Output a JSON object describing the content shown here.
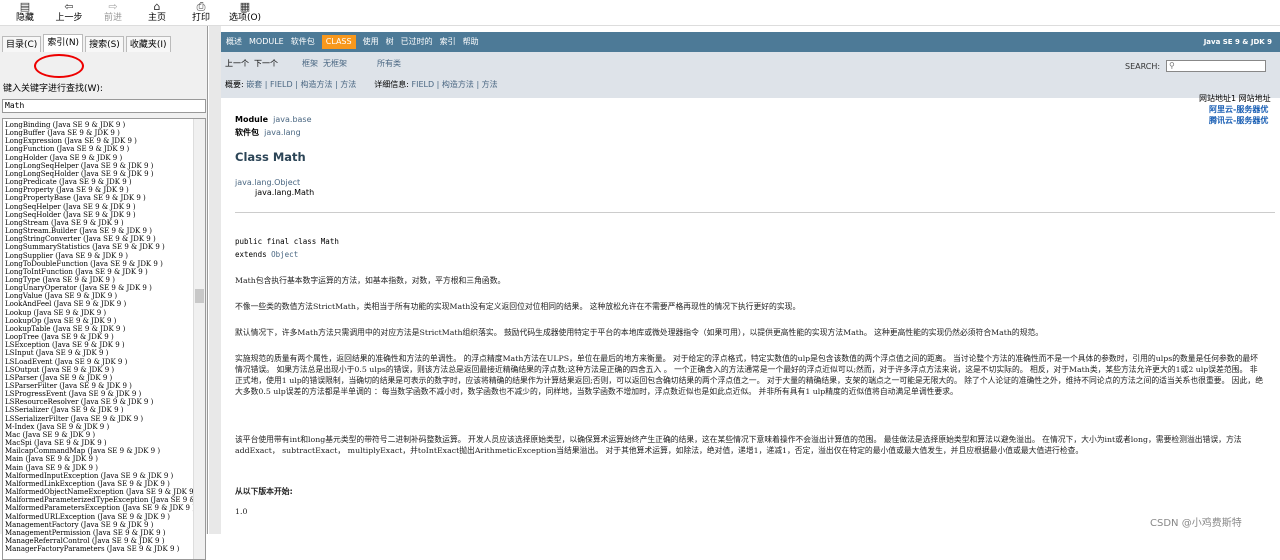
{
  "toolbar": {
    "items": [
      {
        "label": "隐藏",
        "icon": "hide-icon",
        "disabled": false
      },
      {
        "label": "上一步",
        "icon": "back-arrow-icon",
        "disabled": false
      },
      {
        "label": "前进",
        "icon": "forward-arrow-icon",
        "disabled": true
      },
      {
        "label": "主页",
        "icon": "home-icon",
        "disabled": false
      },
      {
        "label": "打印",
        "icon": "print-icon",
        "disabled": false
      },
      {
        "label": "选项(O)",
        "icon": "options-icon",
        "disabled": false
      }
    ]
  },
  "sidebar": {
    "tabs": [
      {
        "label": "目录(C)",
        "active": false
      },
      {
        "label": "索引(N)",
        "active": true
      },
      {
        "label": "搜索(S)",
        "active": false
      },
      {
        "label": "收藏夹(I)",
        "active": false
      }
    ],
    "keyword_label": "键入关键字进行查找(W):",
    "keyword_value": "Math",
    "index_items": [
      "LongBinding (Java SE 9 & JDK 9 )",
      "LongBuffer (Java SE 9 & JDK 9 )",
      "LongExpression (Java SE 9 & JDK 9 )",
      "LongFunction (Java SE 9 & JDK 9 )",
      "LongHolder (Java SE 9 & JDK 9 )",
      "LongLongSeqHelper (Java SE 9 & JDK 9 )",
      "LongLongSeqHolder (Java SE 9 & JDK 9 )",
      "LongPredicate (Java SE 9 & JDK 9 )",
      "LongProperty (Java SE 9 & JDK 9 )",
      "LongPropertyBase (Java SE 9 & JDK 9 )",
      "LongSeqHelper (Java SE 9 & JDK 9 )",
      "LongSeqHolder (Java SE 9 & JDK 9 )",
      "LongStream (Java SE 9 & JDK 9 )",
      "LongStream.Builder (Java SE 9 & JDK 9 )",
      "LongStringConverter (Java SE 9 & JDK 9 )",
      "LongSummaryStatistics (Java SE 9 & JDK 9 )",
      "LongSupplier (Java SE 9 & JDK 9 )",
      "LongToDoubleFunction (Java SE 9 & JDK 9 )",
      "LongToIntFunction (Java SE 9 & JDK 9 )",
      "LongType (Java SE 9 & JDK 9 )",
      "LongUnaryOperator (Java SE 9 & JDK 9 )",
      "LongValue (Java SE 9 & JDK 9 )",
      "LookAndFeel (Java SE 9 & JDK 9 )",
      "Lookup (Java SE 9 & JDK 9 )",
      "LookupOp (Java SE 9 & JDK 9 )",
      "LookupTable (Java SE 9 & JDK 9 )",
      "LoopTree (Java SE 9 & JDK 9 )",
      "LSException (Java SE 9 & JDK 9 )",
      "LSInput (Java SE 9 & JDK 9 )",
      "LSLoadEvent (Java SE 9 & JDK 9 )",
      "LSOutput (Java SE 9 & JDK 9 )",
      "LSParser (Java SE 9 & JDK 9 )",
      "LSParserFilter (Java SE 9 & JDK 9 )",
      "LSProgressEvent (Java SE 9 & JDK 9 )",
      "LSResourceResolver (Java SE 9 & JDK 9 )",
      "LSSerializer (Java SE 9 & JDK 9 )",
      "LSSerializerFilter (Java SE 9 & JDK 9 )",
      "M-Index (Java SE 9 & JDK 9 )",
      "Mac (Java SE 9 & JDK 9 )",
      "MacSpi (Java SE 9 & JDK 9 )",
      "MailcapCommandMap (Java SE 9 & JDK 9 )",
      "Main (Java SE 9 & JDK 9 )",
      "Main (Java SE 9 & JDK 9 )",
      "MalformedInputException (Java SE 9 & JDK 9 )",
      "MalformedLinkException (Java SE 9 & JDK 9 )",
      "MalformedObjectNameException (Java SE 9 & JDK 9 )",
      "MalformedParameterizedTypeException (Java SE 9 & JDK 9 )",
      "MalformedParametersException (Java SE 9 & JDK 9 )",
      "MalformedURLException (Java SE 9 & JDK 9 )",
      "ManagementFactory (Java SE 9 & JDK 9 )",
      "ManagementPermission (Java SE 9 & JDK 9 )",
      "ManageReferralControl (Java SE 9 & JDK 9 )",
      "ManagerFactoryParameters (Java SE 9 & JDK 9 )"
    ]
  },
  "navbar": {
    "items": [
      {
        "label": "概述",
        "selected": false
      },
      {
        "label": "MODULE",
        "selected": false
      },
      {
        "label": "软件包",
        "selected": false
      },
      {
        "label": "CLASS",
        "selected": true
      },
      {
        "label": "使用",
        "selected": false
      },
      {
        "label": "树",
        "selected": false
      },
      {
        "label": "已过时的",
        "selected": false
      },
      {
        "label": "索引",
        "selected": false
      },
      {
        "label": "帮助",
        "selected": false
      }
    ],
    "brand": "Java SE 9 & JDK 9"
  },
  "subnav": {
    "prev": "上一个",
    "next": "下一个",
    "frames": "框架",
    "noframes": "无框架",
    "allclasses": "所有类",
    "search_label": "SEARCH:",
    "summary_label": "概要:",
    "summary_items": "嵌套 | FIELD | 构造方法 | 方法",
    "detail_label": "详细信息:",
    "detail_items": "FIELD | 构造方法 | 方法"
  },
  "doc": {
    "module_label": "Module",
    "module_value": "java.base",
    "package_label": "软件包",
    "package_value": "java.lang",
    "class_title": "Class Math",
    "inherit_parent": "java.lang.Object",
    "inherit_child": "java.lang.Math",
    "sig_line1": "public final class Math",
    "sig_line2_kw": "extends",
    "sig_line2_val": "Object",
    "p1": "Math包含执行基本数字运算的方法，如基本指数，对数，平方根和三角函数。",
    "p2": "不像一些类的数值方法StrictMath，类相当于所有功能的实现Math没有定义返回位对位相同的结果。 这种放松允许在不需要严格再现性的情况下执行更好的实现。",
    "p3": "默认情况下，许多Math方法只需调用中的对应方法是StrictMath组织落实。 鼓励代码生成器使用特定于平台的本地库或微处理器指令（如果可用），以提供更高性能的实现方法Math。 这种更高性能的实现仍然必须符合Math的规范。",
    "p4": "实施规范的质量有两个属性，返回结果的准确性和方法的单调性。 的浮点精度Math方法在ULPS，单位在最后的地方来衡量。 对于给定的浮点格式，特定实数值的ulp是包含该数值的两个浮点值之间的距离。 当讨论整个方法的准确性而不是一个具体的参数时，引用的ulps的数量是任何参数的最坏情况错误。 如果方法总是出现小于0.5 ulps的错误，则该方法总是返回最接近精确结果的浮点数;这种方法是正确的四舍五入 。 一个正确舍入的方法通常是一个最好的浮点近似可以;然而，对于许多浮点方法来说，这是不切实际的。 相反，对于Math类，某些方法允许更大的1或2 ulp误差范围。 非正式地，使用1 ulp的错误限制，当确切的结果是可表示的数字时，应该将精确的结果作为计算结果返回;否则，可以返回包含确切结果的两个浮点值之一。 对于大量的精确结果，支架的端点之一可能是无限大的。 除了个人论证的准确性之外，维持不同论点的方法之间的适当关系也很重要。 因此，绝大多数0.5 ulp误差的方法都是半单调的 ：每当数学函数不减小时，数学函数也不减少的，同样地，当数学函数不增加时，浮点数近似也是如此点近似。 并非所有具有1 ulp精度的近似值将自动满足单调性要求。",
    "p5": "该平台使用带有int和long基元类型的带符号二进制补码整数运算。 开发人员应该选择原始类型，以确保算术运算始终产生正确的结果，这在某些情况下意味着操作不会溢出计算值的范围。 最佳做法是选择原始类型和算法以避免溢出。 在情况下，大小为int或者long，需要检测溢出错误，方法addExact， subtractExact， multiplyExact，并toIntExact抛出ArithmeticException当结果溢出。 对于其他算术运算，如除法，绝对值，递增1，递减1，否定，溢出仅在特定的最小值或最大值发生，并且应根据最小值或最大值进行检查。",
    "since_label": "从以下版本开始:",
    "since_value": "1.0"
  },
  "ads": {
    "line1": "网站地址1 网站地址",
    "line2": "阿里云-服务器优",
    "line3": "腾讯云-服务器优"
  },
  "watermark": "CSDN @小鸡费斯特"
}
